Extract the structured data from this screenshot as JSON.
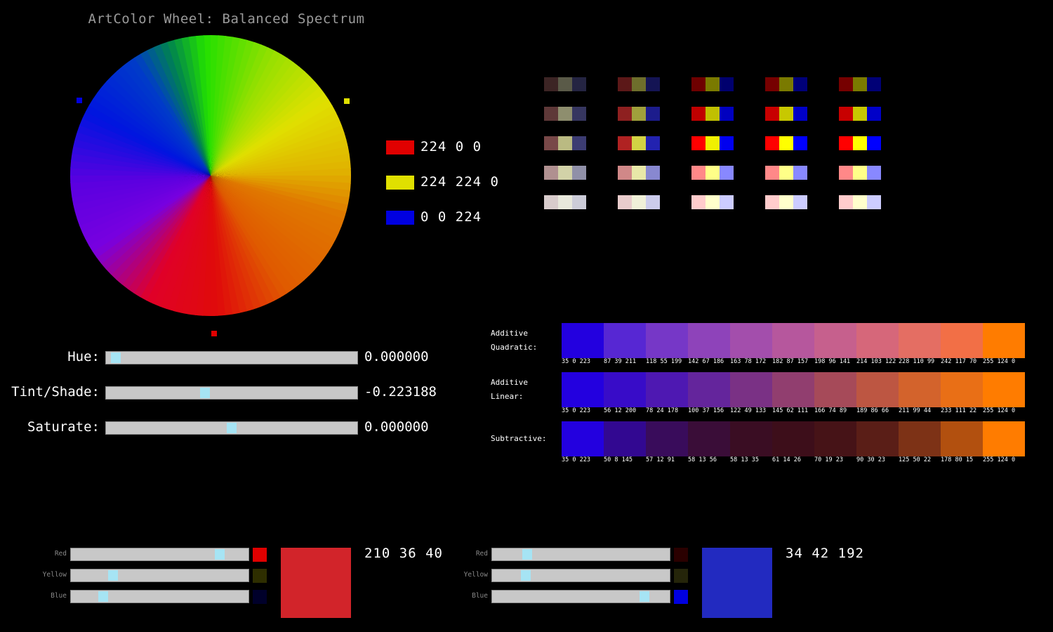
{
  "title": "ArtColor Wheel: Balanced Spectrum",
  "markers": [
    "#0000e0",
    "#e0e000",
    "#e00000"
  ],
  "legend": [
    {
      "color": "#e00000",
      "text": "224 0 0"
    },
    {
      "color": "#e0e000",
      "text": "224 224 0"
    },
    {
      "color": "#0000e0",
      "text": "0 0 224"
    }
  ],
  "palette": [
    [
      [
        "#3c2424",
        "#5a5a48",
        "#242442"
      ],
      [
        "#5c1818",
        "#6e6e2c",
        "#141454"
      ],
      [
        "#6e0000",
        "#7a7a00",
        "#00006e"
      ],
      [
        "#760000",
        "#7a7a00",
        "#000078"
      ],
      [
        "#760000",
        "#7a7a00",
        "#000076"
      ]
    ],
    [
      [
        "#5e3838",
        "#8e8e6e",
        "#363660"
      ],
      [
        "#8e2020",
        "#a0a03c",
        "#1c1c8c"
      ],
      [
        "#c00000",
        "#c0c000",
        "#0000c0"
      ],
      [
        "#c80000",
        "#c8c800",
        "#0000c8"
      ],
      [
        "#c80000",
        "#c8c800",
        "#0000c8"
      ]
    ],
    [
      [
        "#784848",
        "#baba82",
        "#3c3c72"
      ],
      [
        "#b02222",
        "#d2d244",
        "#2222b0"
      ],
      [
        "#ff0000",
        "#f0f000",
        "#0000f0"
      ],
      [
        "#ff0000",
        "#ffff00",
        "#0000ff"
      ],
      [
        "#ff0000",
        "#ffff00",
        "#0000ff"
      ]
    ],
    [
      [
        "#b09090",
        "#d2d2a8",
        "#9090a8"
      ],
      [
        "#d08888",
        "#e8e8a8",
        "#8888d0"
      ],
      [
        "#ff8888",
        "#ffff88",
        "#8888ff"
      ],
      [
        "#ff8888",
        "#ffff88",
        "#8888ff"
      ],
      [
        "#ff8888",
        "#ffff88",
        "#8888ff"
      ]
    ],
    [
      [
        "#d8cccc",
        "#e8e8dc",
        "#ccccd8"
      ],
      [
        "#e8cccc",
        "#f0f0d8",
        "#ccccec"
      ],
      [
        "#ffcccc",
        "#ffffcc",
        "#ccccff"
      ],
      [
        "#ffcccc",
        "#ffffcc",
        "#ccccff"
      ],
      [
        "#ffcccc",
        "#ffffcc",
        "#ccccff"
      ]
    ]
  ],
  "sliders": [
    {
      "label": "Hue:",
      "value": "0.000000",
      "pos": 0.02
    },
    {
      "label": "Tint/Shade:",
      "value": "-0.223188",
      "pos": 0.39
    },
    {
      "label": "Saturate:",
      "value": "0.000000",
      "pos": 0.5
    }
  ],
  "gradients": [
    {
      "label": [
        "Additive",
        "Quadratic:"
      ],
      "cells": [
        {
          "color": "#2300df",
          "text": "35 0 223"
        },
        {
          "color": "#5727d3",
          "text": "87 39 211"
        },
        {
          "color": "#7637c7",
          "text": "118 55 199"
        },
        {
          "color": "#8e43ba",
          "text": "142 67 186"
        },
        {
          "color": "#a34eac",
          "text": "163 78 172"
        },
        {
          "color": "#b6579d",
          "text": "182 87 157"
        },
        {
          "color": "#c6608d",
          "text": "198 96 141"
        },
        {
          "color": "#d6677a",
          "text": "214 103 122"
        },
        {
          "color": "#e46e63",
          "text": "228 110 99"
        },
        {
          "color": "#f26f46",
          "text": "242 117 70"
        },
        {
          "color": "#ff7c00",
          "text": "255 124 0"
        }
      ]
    },
    {
      "label": [
        "Additive",
        "Linear:"
      ],
      "cells": [
        {
          "color": "#2300df",
          "text": "35 0 223"
        },
        {
          "color": "#380cc8",
          "text": "56 12 200"
        },
        {
          "color": "#4e18b2",
          "text": "78 24 178"
        },
        {
          "color": "#64259c",
          "text": "100 37 156"
        },
        {
          "color": "#7a3185",
          "text": "122 49 133"
        },
        {
          "color": "#913e6f",
          "text": "145 62 111"
        },
        {
          "color": "#a64a59",
          "text": "166 74 89"
        },
        {
          "color": "#bd5642",
          "text": "189 86 66"
        },
        {
          "color": "#d3632c",
          "text": "211 99 44"
        },
        {
          "color": "#e96f16",
          "text": "233 111 22"
        },
        {
          "color": "#ff7c00",
          "text": "255 124 0"
        }
      ]
    },
    {
      "label": [
        "Subtractive:"
      ],
      "cells": [
        {
          "color": "#2300df",
          "text": "35 0 223"
        },
        {
          "color": "#320891",
          "text": "50 8 145"
        },
        {
          "color": "#390c5b",
          "text": "57 12 91"
        },
        {
          "color": "#3a0d38",
          "text": "58 13 56"
        },
        {
          "color": "#3a0d23",
          "text": "58 13 35"
        },
        {
          "color": "#3d0e1a",
          "text": "61 14 26"
        },
        {
          "color": "#461317",
          "text": "70 19 23"
        },
        {
          "color": "#5a1e17",
          "text": "90 30 23"
        },
        {
          "color": "#7d3216",
          "text": "125 50 22"
        },
        {
          "color": "#b2500f",
          "text": "178 80 15"
        },
        {
          "color": "#ff7c00",
          "text": "255 124 0"
        }
      ]
    }
  ],
  "mixers": [
    {
      "rows": [
        {
          "label": "Red",
          "pos": 0.85,
          "swatch": "#e00000"
        },
        {
          "label": "Yellow",
          "pos": 0.22,
          "swatch": "#2e2e00"
        },
        {
          "label": "Blue",
          "pos": 0.16,
          "swatch": "#00002a"
        }
      ],
      "result": "#d2242a",
      "rgb": "210 36 40"
    },
    {
      "rows": [
        {
          "label": "Red",
          "pos": 0.18,
          "swatch": "#2a0000"
        },
        {
          "label": "Yellow",
          "pos": 0.17,
          "swatch": "#25250a"
        },
        {
          "label": "Blue",
          "pos": 0.87,
          "swatch": "#0000e0"
        }
      ],
      "result": "#222ac0",
      "rgb": "34 42 192"
    }
  ]
}
